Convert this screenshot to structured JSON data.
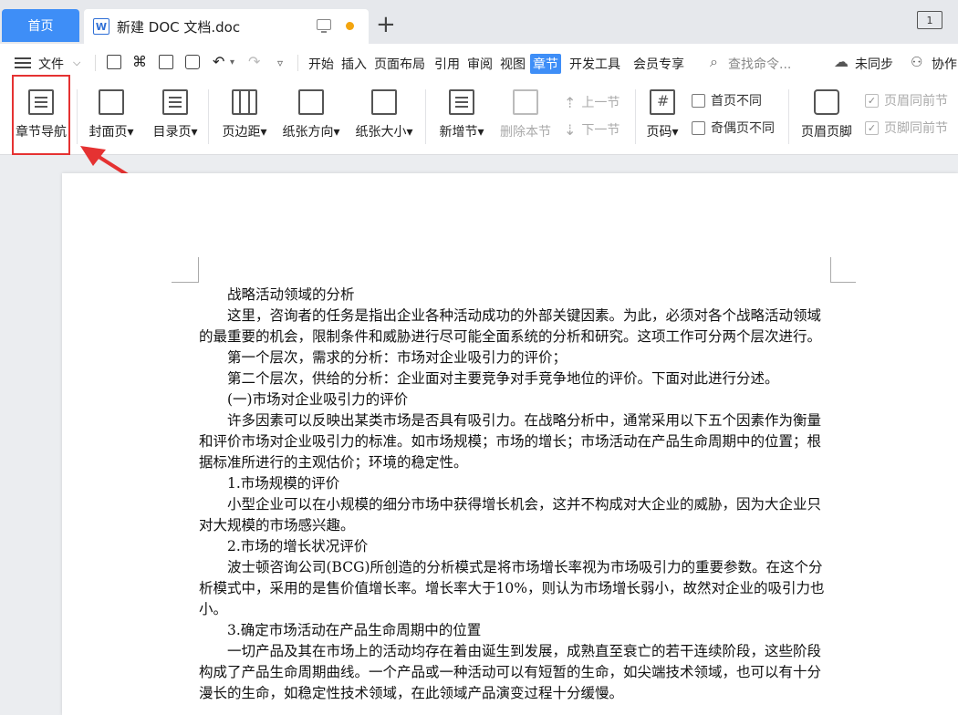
{
  "tabs": {
    "home": "首页",
    "document_title": "新建 DOC 文档.doc",
    "add": "+",
    "window_count": "1"
  },
  "menu": {
    "file": "文件",
    "items": [
      "开始",
      "插入",
      "页面布局",
      "引用",
      "审阅",
      "视图",
      "章节",
      "开发工具",
      "会员专享"
    ],
    "active": "章节",
    "search_placeholder": "查找命令...",
    "sync": "未同步",
    "collab": "协作"
  },
  "ribbon": {
    "section_nav": "章节导航",
    "cover": "封面页",
    "toc": "目录页",
    "margin": "页边距",
    "orientation": "纸张方向",
    "size": "纸张大小",
    "new_section": "新增节",
    "delete_section": "删除本节",
    "prev_section": "上一节",
    "next_section": "下一节",
    "page_number": "页码",
    "first_page_diff": "首页不同",
    "odd_even_diff": "奇偶页不同",
    "header_footer": "页眉页脚",
    "header_same": "页眉同前节",
    "footer_same": "页脚同前节"
  },
  "document": {
    "paragraphs": [
      "战略活动领域的分析",
      "这里，咨询者的任务是指出企业各种活动成功的外部关键因素。为此，必须对各个战略活动领域的最重要的机会，限制条件和威胁进行尽可能全面系统的分析和研究。这项工作可分两个层次进行。",
      "第一个层次，需求的分析：市场对企业吸引力的评价；",
      "第二个层次，供给的分析：企业面对主要竞争对手竞争地位的评价。下面对此进行分述。",
      "(一)市场对企业吸引力的评价",
      "许多因素可以反映出某类市场是否具有吸引力。在战略分析中，通常采用以下五个因素作为衡量和评价市场对企业吸引力的标准。如市场规模；市场的增长；市场活动在产品生命周期中的位置；根据标准所进行的主观估价；环境的稳定性。",
      "1.市场规模的评价",
      "小型企业可以在小规模的细分市场中获得增长机会，这并不构成对大企业的威胁，因为大企业只对大规模的市场感兴趣。",
      "2.市场的增长状况评价",
      "波士顿咨询公司(BCG)所创造的分析模式是将市场增长率视为市场吸引力的重要参数。在这个分析模式中，采用的是售价值增长率。增长率大于10%，则认为市场增长弱小，故然对企业的吸引力也小。",
      "3.确定市场活动在产品生命周期中的位置",
      "一切产品及其在市场上的活动均存在着由诞生到发展，成熟直至衰亡的若干连续阶段，这些阶段构成了产品生命周期曲线。一个产品或一种活动可以有短暂的生命，如尖端技术领域，也可以有十分漫长的生命，如稳定性技术领域，在此领域产品演变过程十分缓慢。"
    ]
  },
  "colors": {
    "accent": "#3e8ef7",
    "highlight": "#e53232"
  }
}
